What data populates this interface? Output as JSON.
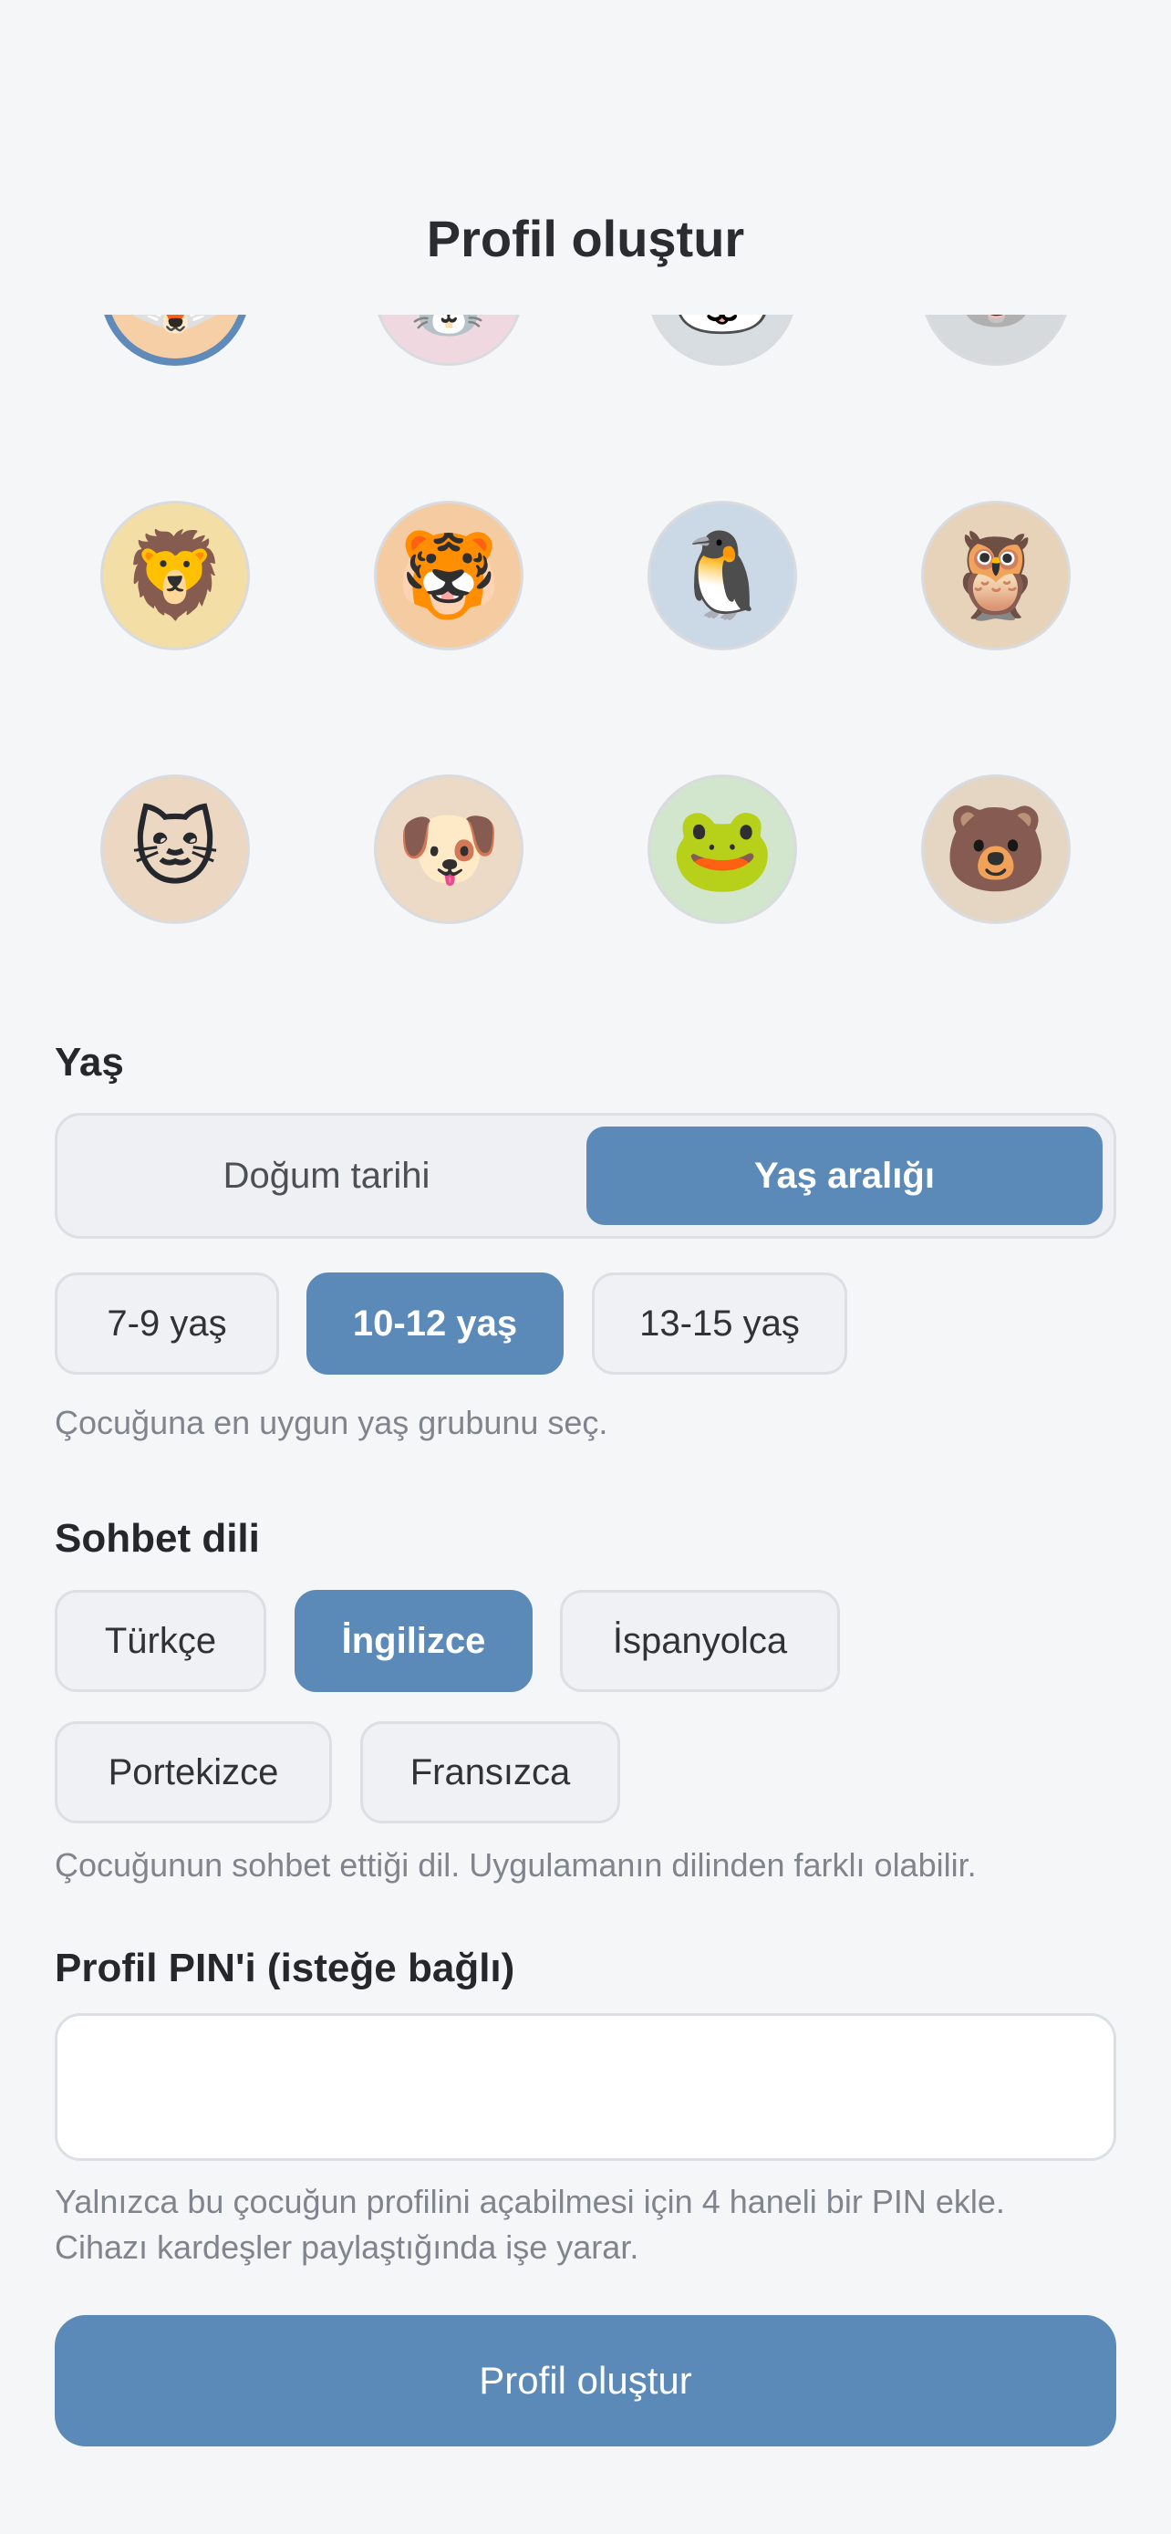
{
  "header": {
    "title": "Profil oluştur"
  },
  "avatars": [
    {
      "name": "fox",
      "emoji": "🦊",
      "bg": "#f6cfa6",
      "selected": true
    },
    {
      "name": "bunny",
      "emoji": "🐰",
      "bg": "#f0d8e1",
      "selected": false
    },
    {
      "name": "panda",
      "emoji": "🐼",
      "bg": "#d8dde1",
      "selected": false
    },
    {
      "name": "koala",
      "emoji": "🐨",
      "bg": "#d6dadd",
      "selected": false
    },
    {
      "name": "lion",
      "emoji": "🦁",
      "bg": "#f3dea6",
      "selected": false
    },
    {
      "name": "tiger",
      "emoji": "🐯",
      "bg": "#f5cca2",
      "selected": false
    },
    {
      "name": "penguin",
      "emoji": "🐧",
      "bg": "#cbd9e6",
      "selected": false
    },
    {
      "name": "owl",
      "emoji": "🦉",
      "bg": "#e6d3b9",
      "selected": false
    },
    {
      "name": "cat",
      "emoji": "🐱",
      "bg": "#ecd7c2",
      "selected": false
    },
    {
      "name": "dog",
      "emoji": "🐶",
      "bg": "#ecd9c6",
      "selected": false
    },
    {
      "name": "frog",
      "emoji": "🐸",
      "bg": "#d2e5cd",
      "selected": false
    },
    {
      "name": "bear",
      "emoji": "🐻",
      "bg": "#e5d6c3",
      "selected": false
    }
  ],
  "age": {
    "label": "Yaş",
    "mode_birthdate": "Doğum tarihi",
    "mode_range": "Yaş aralığı",
    "ranges": [
      "7-9 yaş",
      "10-12 yaş",
      "13-15 yaş"
    ],
    "selected_range": "10-12 yaş",
    "hint": "Çocuğuna en uygun yaş grubunu seç."
  },
  "language": {
    "label": "Sohbet dili",
    "options": [
      "Türkçe",
      "İngilizce",
      "İspanyolca",
      "Portekizce",
      "Fransızca"
    ],
    "selected": "İngilizce",
    "hint": "Çocuğunun sohbet ettiği dil. Uygulamanın dilinden farklı olabilir."
  },
  "pin": {
    "label": "Profil PIN'i (isteğe bağlı)",
    "value": "",
    "hint_line1": "Yalnızca bu çocuğun profilini açabilmesi için 4 haneli bir PIN ekle.",
    "hint_line2": "Cihazı kardeşler paylaştığında işe yarar."
  },
  "submit_label": "Profil oluştur",
  "colors": {
    "accent": "#5b8ab8",
    "background": "#f5f6f8"
  }
}
